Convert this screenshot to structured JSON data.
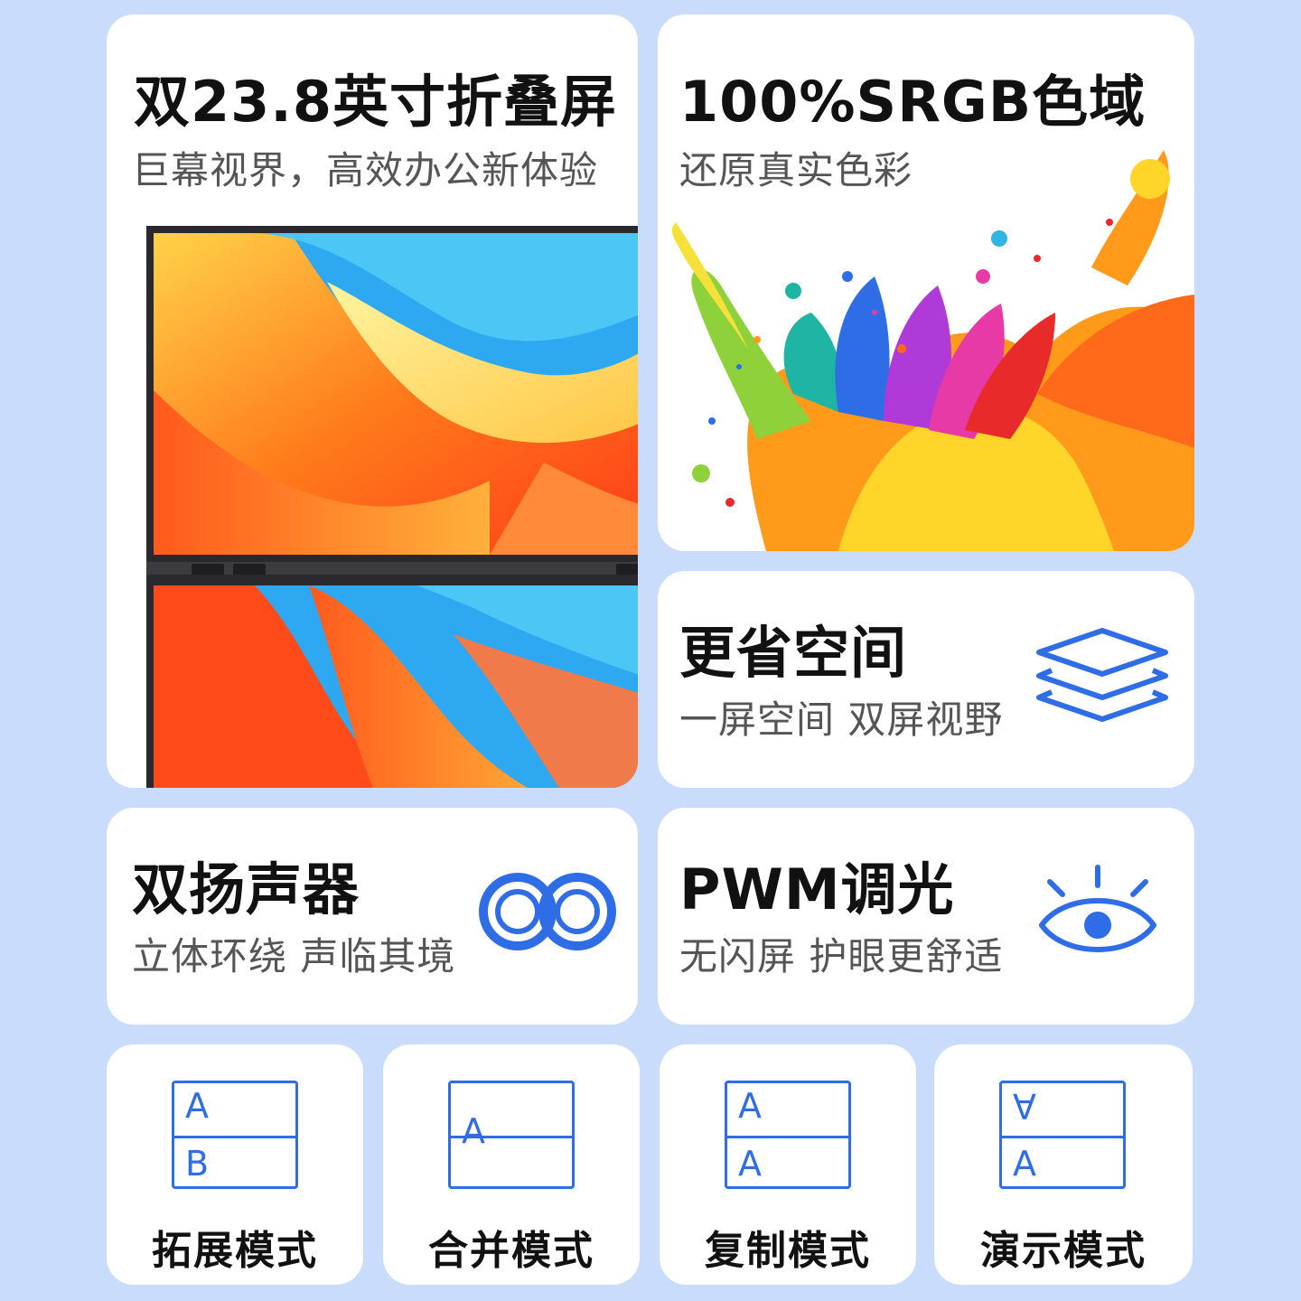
{
  "colors": {
    "background": "#c9dcfb",
    "card": "#ffffff",
    "accent": "#2f6de6",
    "title": "#111111",
    "subtitle": "#555555"
  },
  "card_folding": {
    "title": "双23.8英寸折叠屏",
    "subtitle": "巨幕视界，高效办公新体验"
  },
  "card_color": {
    "title": "100%SRGB色域",
    "subtitle": "还原真实色彩"
  },
  "card_space": {
    "title": "更省空间",
    "subtitle": "一屏空间 双屏视野",
    "icon": "layers-icon"
  },
  "card_speaker": {
    "title": "双扬声器",
    "subtitle": "立体环绕 声临其境",
    "icon": "dual-speaker-icon"
  },
  "card_pwm": {
    "title": "PWM调光",
    "subtitle": "无闪屏 护眼更舒适",
    "icon": "eye-icon"
  },
  "modes": [
    {
      "label": "拓展模式",
      "top_letter": "A",
      "bottom_letter": "B"
    },
    {
      "label": "合并模式",
      "top_letter": "A",
      "bottom_letter": ""
    },
    {
      "label": "复制模式",
      "top_letter": "A",
      "bottom_letter": "A"
    },
    {
      "label": "演示模式",
      "top_letter": "A",
      "bottom_letter": "A"
    }
  ]
}
